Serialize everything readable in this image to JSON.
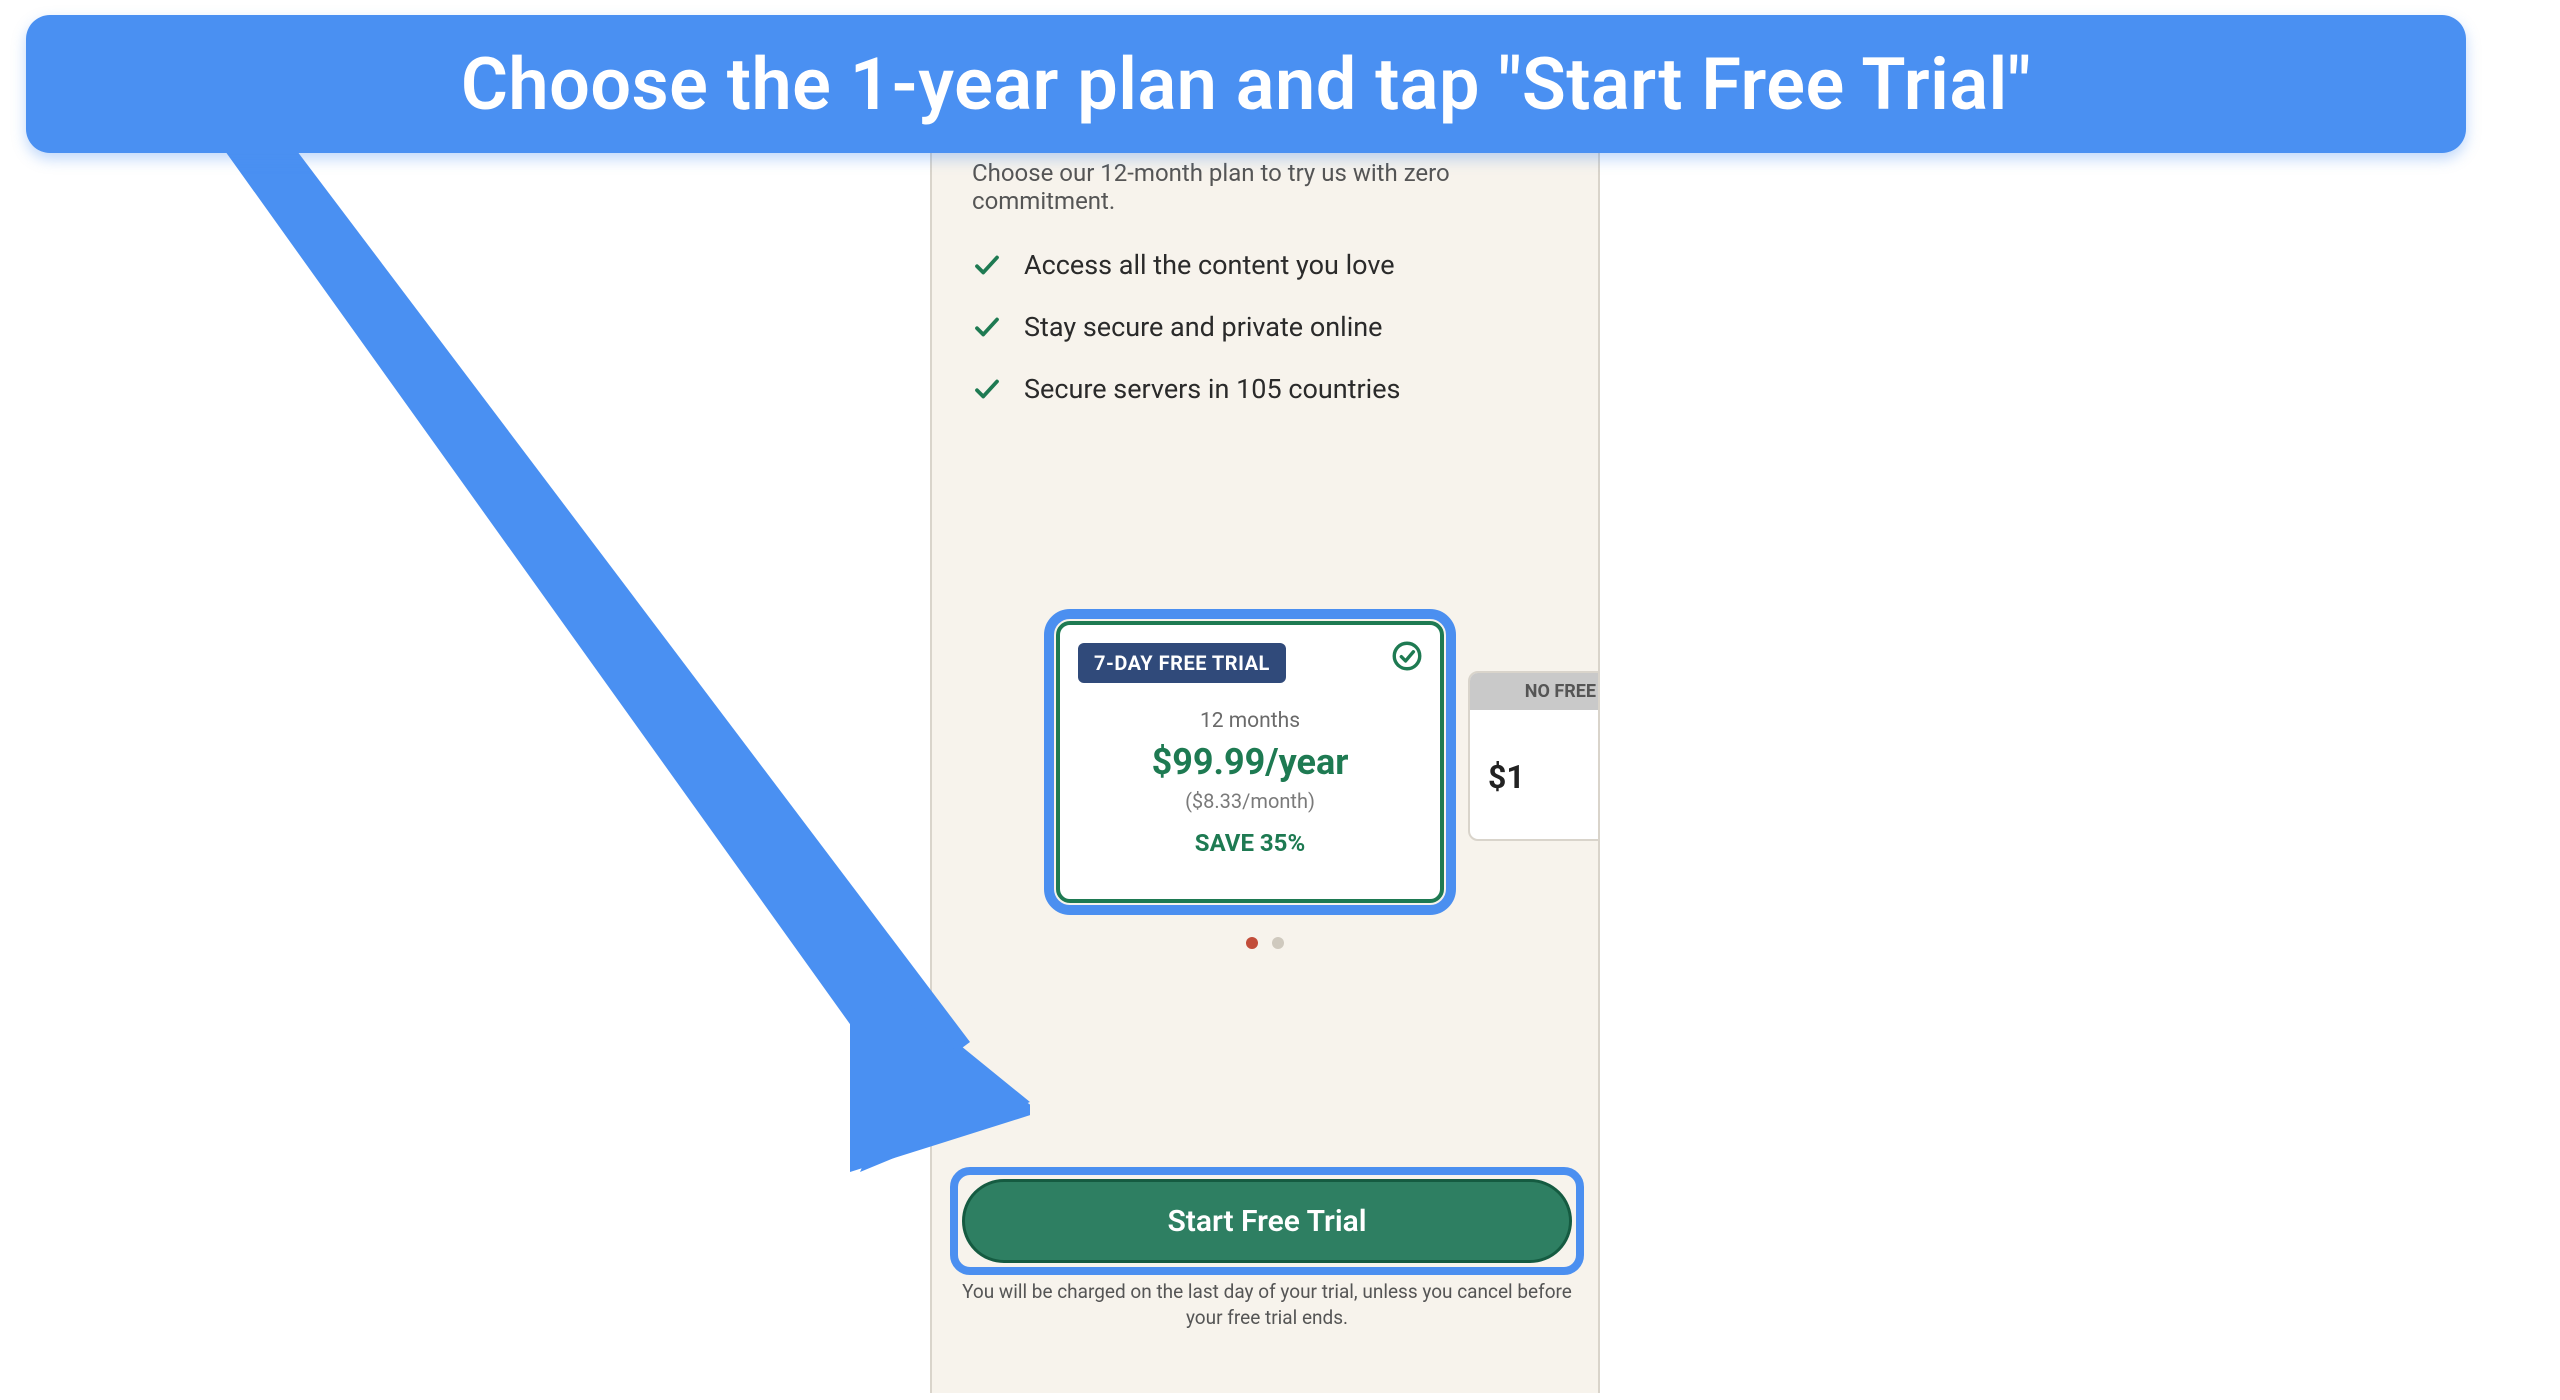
{
  "annotation": {
    "banner_text": "Choose the 1-year plan and tap \"Start Free Trial\""
  },
  "screen": {
    "subheading": "Choose our 12-month plan to try us with zero commitment.",
    "bullets": [
      "Access all the content you love",
      "Stay secure and private online",
      "Secure servers in 105 countries"
    ],
    "primary_plan": {
      "badge": "7-DAY FREE TRIAL",
      "duration": "12 months",
      "price": "$99.99/year",
      "monthly": "($8.33/month)",
      "save": "SAVE 35%"
    },
    "secondary_plan": {
      "badge": "NO FREE T",
      "price": "$1"
    },
    "cta": "Start Free Trial",
    "disclaimer": "You will be charged on the last day of your trial, unless you cancel before your free trial ends."
  },
  "colors": {
    "accent_blue": "#4a90f2",
    "green": "#1e7a52"
  }
}
